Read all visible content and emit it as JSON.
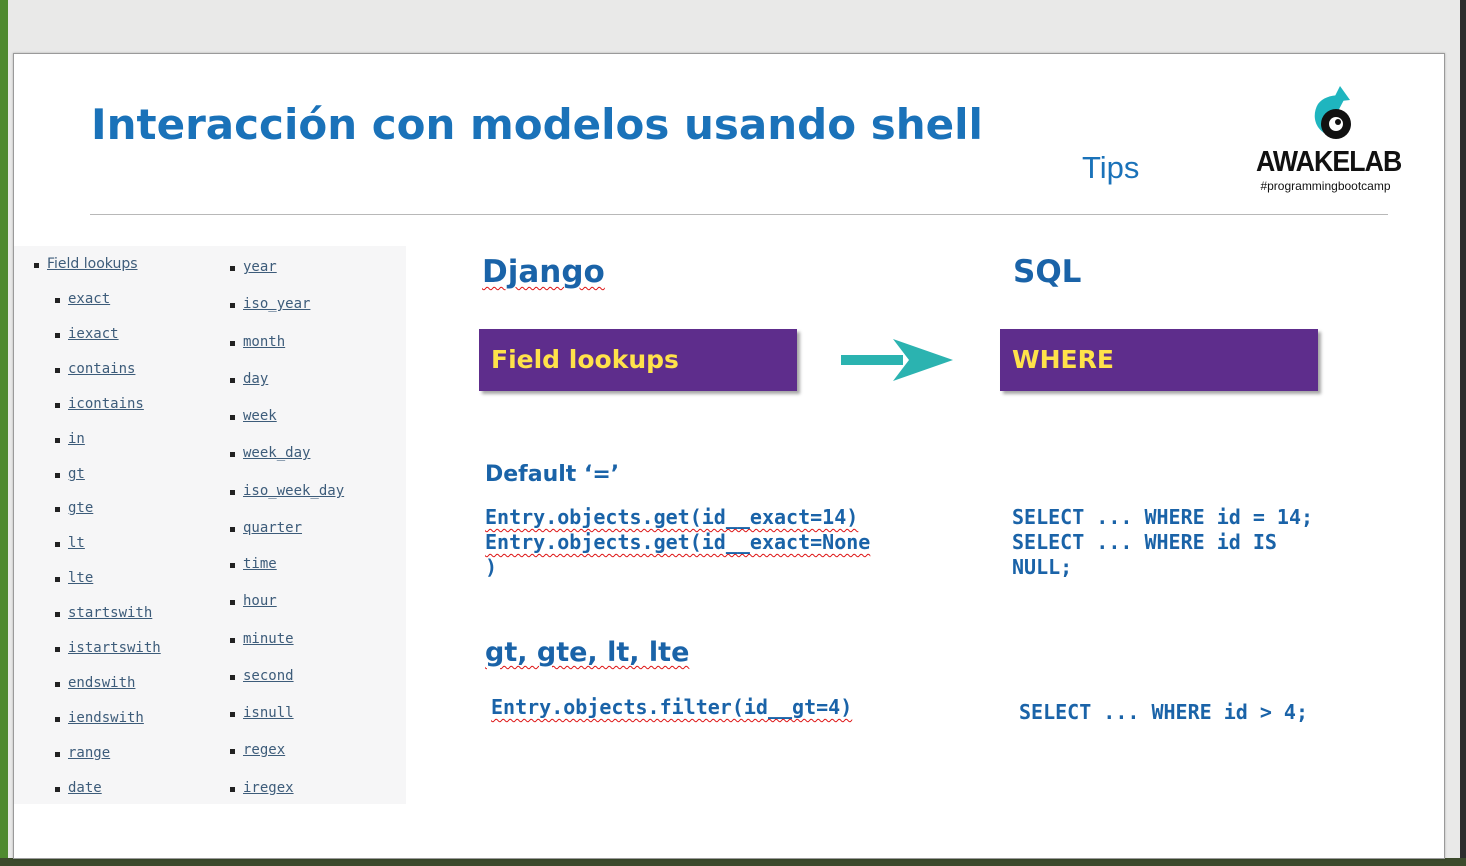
{
  "slide": {
    "title": "Interacción con modelos usando shell",
    "subtitle": "Tips",
    "logo": {
      "name": "AWAKELAB",
      "tagline": "#programmingbootcamp",
      "icon": "awakelab-logo-icon",
      "accent": "#1fb5bf"
    }
  },
  "lookups_list": {
    "heading": "Field lookups",
    "column1": [
      "exact",
      "iexact",
      "contains",
      "icontains",
      "in",
      "gt",
      "gte",
      "lt",
      "lte",
      "startswith",
      "istartswith",
      "endswith",
      "iendswith",
      "range",
      "date"
    ],
    "column2": [
      "year",
      "iso_year",
      "month",
      "day",
      "week",
      "week_day",
      "iso_week_day",
      "quarter",
      "time",
      "hour",
      "minute",
      "second",
      "isnull",
      "regex",
      "iregex"
    ]
  },
  "django_col": {
    "heading": "Django",
    "box_label": "Field lookups"
  },
  "sql_col": {
    "heading": "SQL",
    "box_label": "WHERE"
  },
  "default_section": {
    "heading": "Default ‘=’",
    "django_line1": "Entry.objects.get(id__exact=14)",
    "django_line2": "Entry.objects.get(id__exact=None",
    "django_line3": ")",
    "sql_line1": "SELECT ... WHERE id = 14;",
    "sql_line2": "SELECT ... WHERE id IS",
    "sql_line3": "NULL;"
  },
  "compare_section": {
    "heading": "gt, gte, lt, lte",
    "django_line": "Entry.objects.filter(id__gt=4)",
    "sql_line": "SELECT ... WHERE id > 4;"
  },
  "colors": {
    "title_blue": "#1a72b9",
    "box_purple": "#5e2d8c",
    "box_text_yellow": "#ffe24a",
    "arrow_teal": "#2bb3b0"
  }
}
